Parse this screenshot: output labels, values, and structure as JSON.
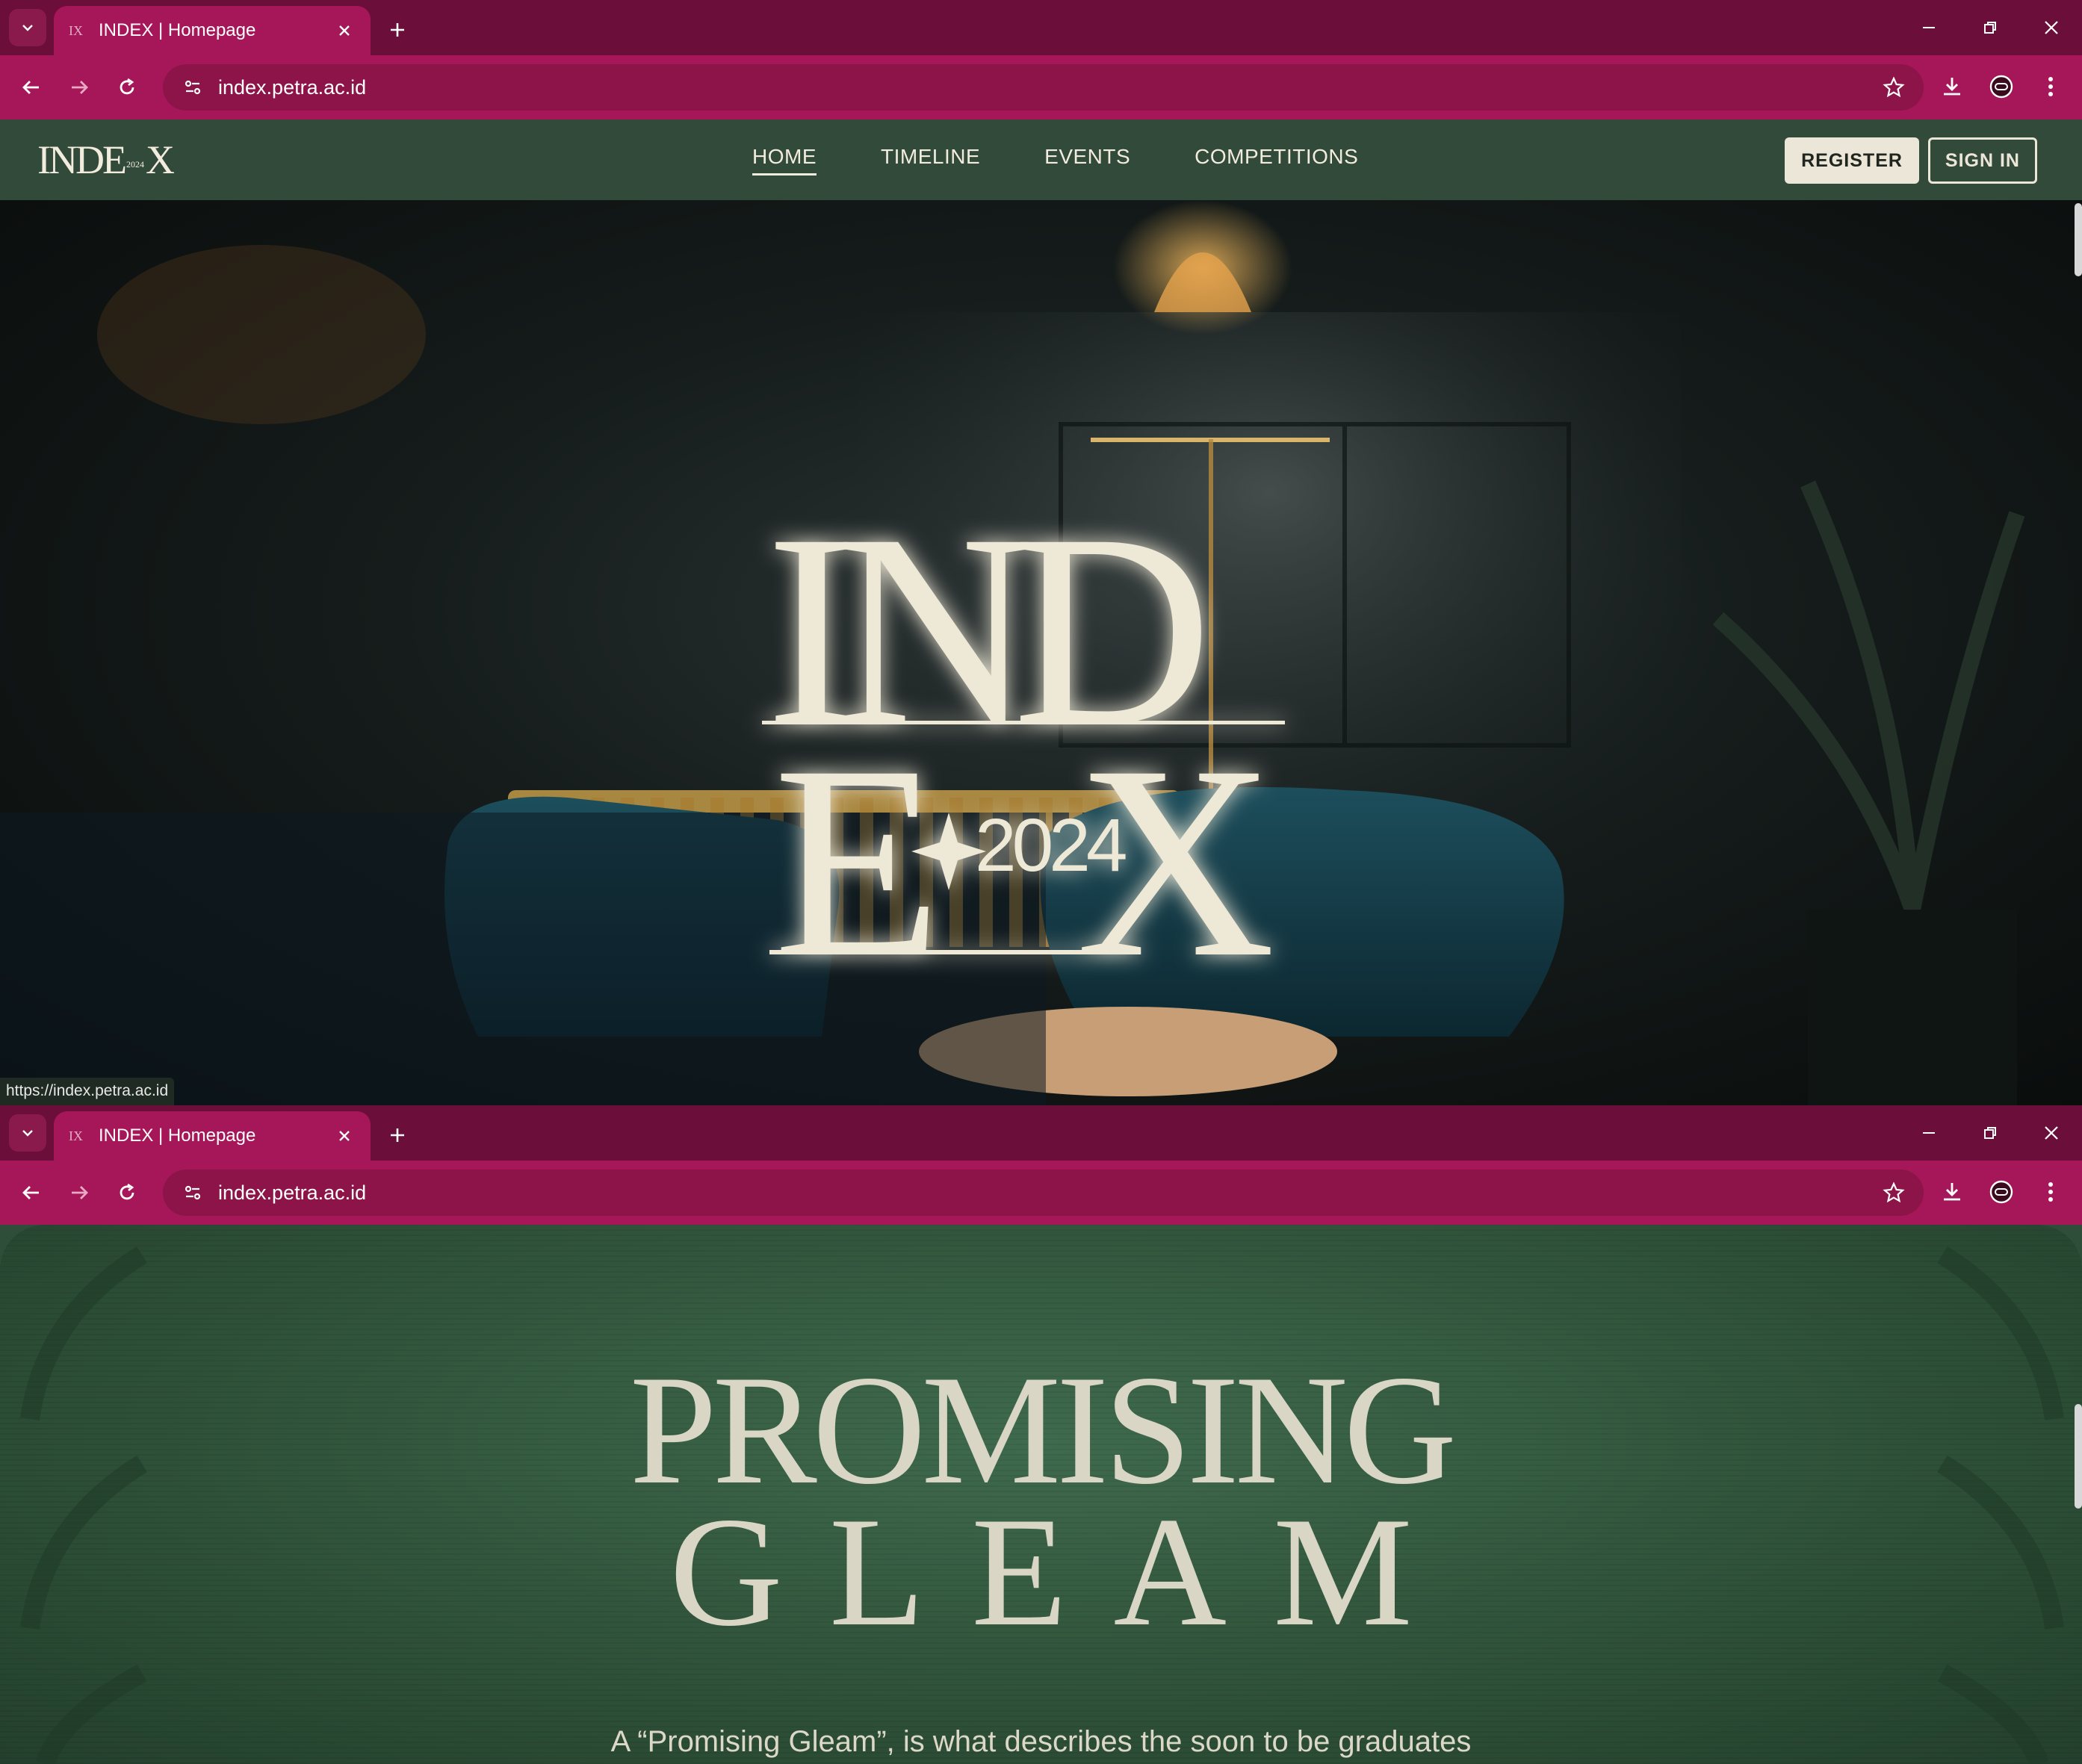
{
  "browser": {
    "tab_title": "INDEX | Homepage",
    "tab_favicon_text": "IX",
    "url": "index.petra.ac.id",
    "status_url": "https://index.petra.ac.id",
    "colors": {
      "tabstrip": "#6b0f3a",
      "toolbar": "#a6175a",
      "omnibox": "#8c1449"
    }
  },
  "site": {
    "logo_text_left": "INDE",
    "logo_small": "2024",
    "logo_text_right": "X",
    "nav": [
      "HOME",
      "TIMELINE",
      "EVENTS",
      "COMPETITIONS"
    ],
    "active_nav": "HOME",
    "register_label": "REGISTER",
    "signin_label": "SIGN IN",
    "colors": {
      "header": "#324a3a",
      "cream": "#f2ecdf"
    }
  },
  "hero": {
    "title_top": "IND",
    "title_bottom_left": "E",
    "title_bottom_right": "X",
    "year": "2024"
  },
  "gleam": {
    "title_line1": "PROMISING",
    "title_line2": "GLEAM",
    "description": "A “Promising Gleam”, is what describes the soon to be graduates"
  }
}
